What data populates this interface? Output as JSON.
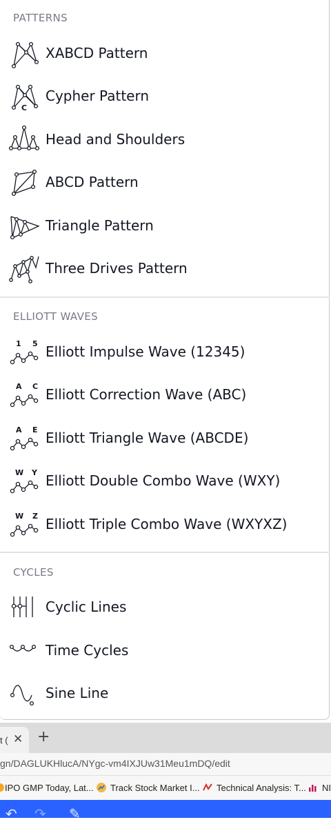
{
  "menu": {
    "sections": [
      {
        "header": "PATTERNS",
        "items": [
          {
            "label": "XABCD Pattern",
            "icon": "xabcd-pattern-icon"
          },
          {
            "label": "Cypher Pattern",
            "icon": "cypher-pattern-icon"
          },
          {
            "label": "Head and Shoulders",
            "icon": "head-and-shoulders-icon"
          },
          {
            "label": "ABCD Pattern",
            "icon": "abcd-pattern-icon"
          },
          {
            "label": "Triangle Pattern",
            "icon": "triangle-pattern-icon"
          },
          {
            "label": "Three Drives Pattern",
            "icon": "three-drives-pattern-icon"
          }
        ]
      },
      {
        "header": "ELLIOTT WAVES",
        "items": [
          {
            "label": "Elliott Impulse Wave (12345)",
            "icon": "elliott-impulse-wave-icon",
            "glyph_left": "1",
            "glyph_right": "5"
          },
          {
            "label": "Elliott Correction Wave (ABC)",
            "icon": "elliott-correction-wave-icon",
            "glyph_left": "A",
            "glyph_right": "C"
          },
          {
            "label": "Elliott Triangle Wave (ABCDE)",
            "icon": "elliott-triangle-wave-icon",
            "glyph_left": "A",
            "glyph_right": "E"
          },
          {
            "label": "Elliott Double Combo Wave (WXY)",
            "icon": "elliott-double-combo-wave-icon",
            "glyph_left": "W",
            "glyph_right": "Y"
          },
          {
            "label": "Elliott Triple Combo Wave (WXYXZ)",
            "icon": "elliott-triple-combo-wave-icon",
            "glyph_left": "W",
            "glyph_right": "Z"
          }
        ]
      },
      {
        "header": "CYCLES",
        "items": [
          {
            "label": "Cyclic Lines",
            "icon": "cyclic-lines-icon"
          },
          {
            "label": "Time Cycles",
            "icon": "time-cycles-icon"
          },
          {
            "label": "Sine Line",
            "icon": "sine-line-icon"
          }
        ]
      }
    ]
  },
  "browser": {
    "tab_title": "t (",
    "tab_close": "✕",
    "new_tab": "+",
    "url": "gn/DAGLUKHlucA/NYgc-vm4IXJUw31Meu1mDQ/edit",
    "bookmarks": [
      {
        "label": "IPO GMP Today, Lat...",
        "icon": "ipo-gmp-icon"
      },
      {
        "label": "Track Stock Market I...",
        "icon": "track-stock-market-icon"
      },
      {
        "label": "Technical Analysis: T...",
        "icon": "technical-analysis-icon"
      },
      {
        "label": "NI",
        "icon": "bar-chart-icon"
      }
    ]
  },
  "colors": {
    "accent": "#2962ff",
    "text": "#131722",
    "section_header": "#787b86",
    "divider": "#e0e3eb"
  }
}
